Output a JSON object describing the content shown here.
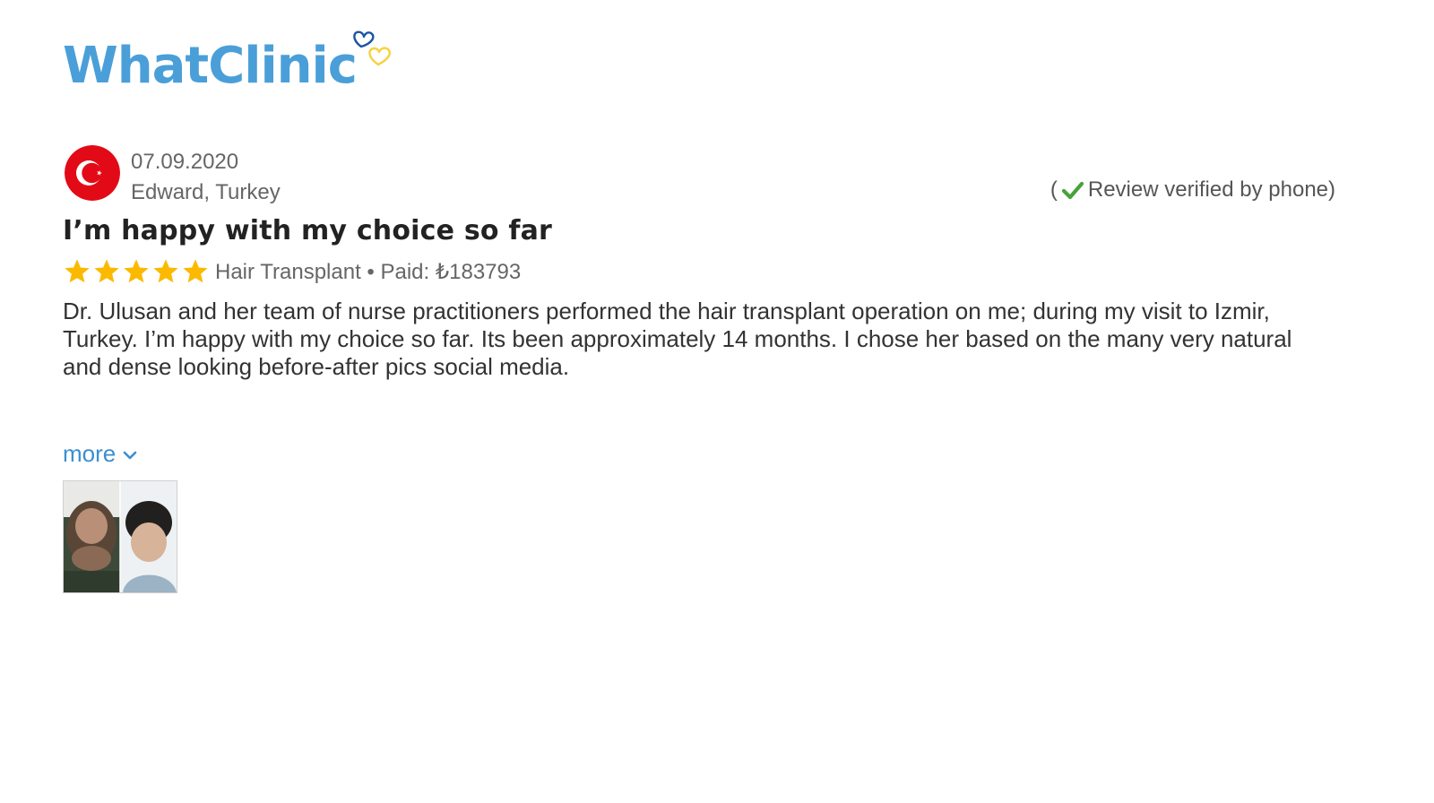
{
  "brand": {
    "name": "WhatClinic",
    "color": "#4a9fd8",
    "heart_colors": [
      "#1d55a3",
      "#f7d23e"
    ]
  },
  "review": {
    "date": "07.09.2020",
    "author": "Edward, Turkey",
    "country_flag": "turkey-flag",
    "verified_open": "(",
    "verified_label": "Review verified by phone)",
    "title": "I’m happy with my choice so far",
    "rating": 5,
    "rating_max": 5,
    "treatment": "Hair Transplant • Paid: ₺183793",
    "body": "Dr. Ulusan and her team of nurse practitioners performed the hair transplant operation on me; during my visit to Izmir, Turkey. I’m happy with my choice so far. Its been approximately 14 months. I chose her based on the many very natural and dense looking before-after pics social media.",
    "more_label": "more",
    "accent_colors": {
      "star": "#fbb900",
      "check": "#4aa13b",
      "link": "#3b8fd0",
      "flag_red": "#e30a17"
    }
  }
}
